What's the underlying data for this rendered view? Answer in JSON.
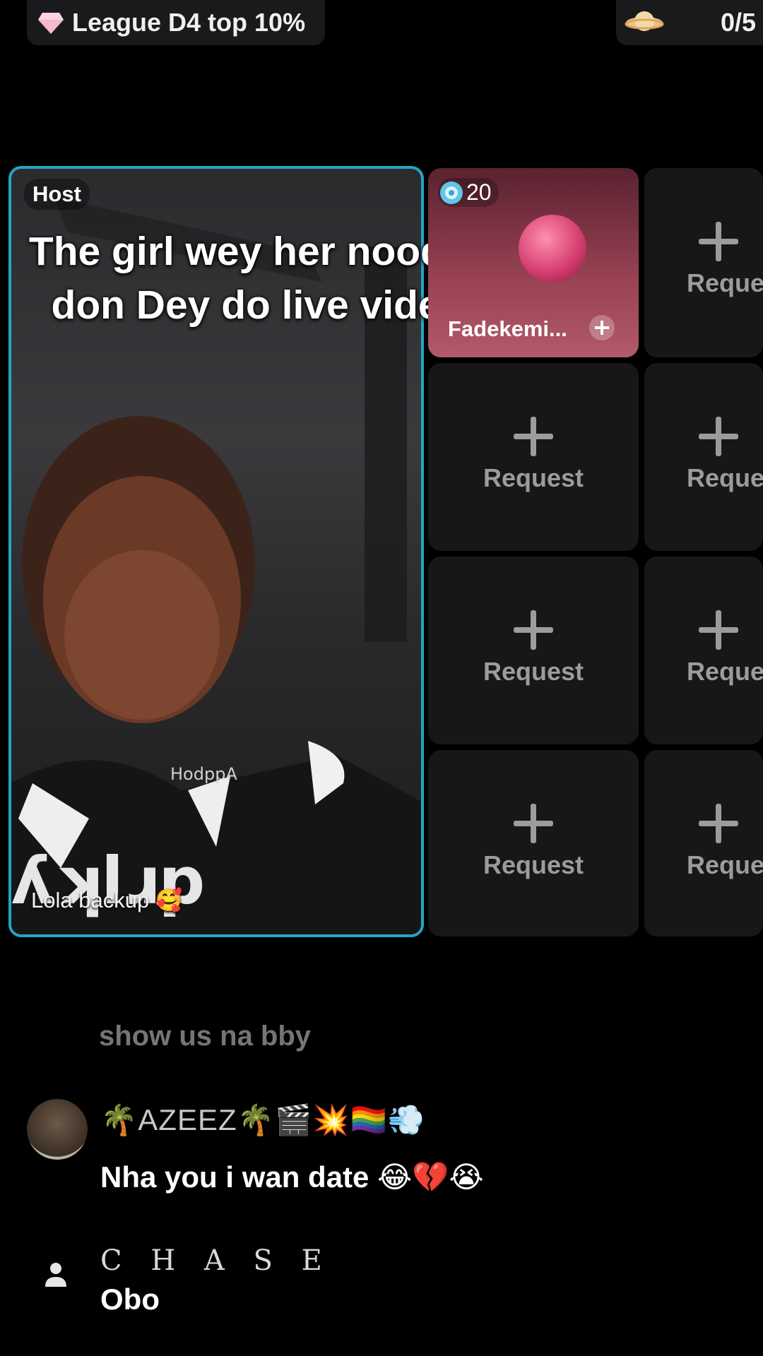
{
  "top_bar": {
    "league_label": "League D4 top 10%",
    "counter_label": "0/5"
  },
  "host_tile": {
    "tag": "Host",
    "name": "Lola backup 🥰"
  },
  "caption": "The girl wey her noodles cast don Dey do live video 😭😂",
  "guest_tile": {
    "score": "20",
    "name": "Fadekemi..."
  },
  "request_label": "Request",
  "request_label_cut": "Reque",
  "chat": {
    "faded_message": "show us na bby",
    "messages": [
      {
        "user": "🌴AZEEZ🌴🎬💥🏳️‍🌈💨",
        "text": "Nha you i wan date 😂💔😭"
      },
      {
        "user": "C H A S E",
        "text": "Obo"
      }
    ]
  },
  "colors": {
    "host_border": "#22a6c4",
    "background": "#000000",
    "slot_bg": "#171719",
    "request_text": "#9c9c9f"
  },
  "icons": [
    "gem-icon",
    "planet-icon",
    "plus-icon",
    "star-badge-icon",
    "person-icon"
  ]
}
